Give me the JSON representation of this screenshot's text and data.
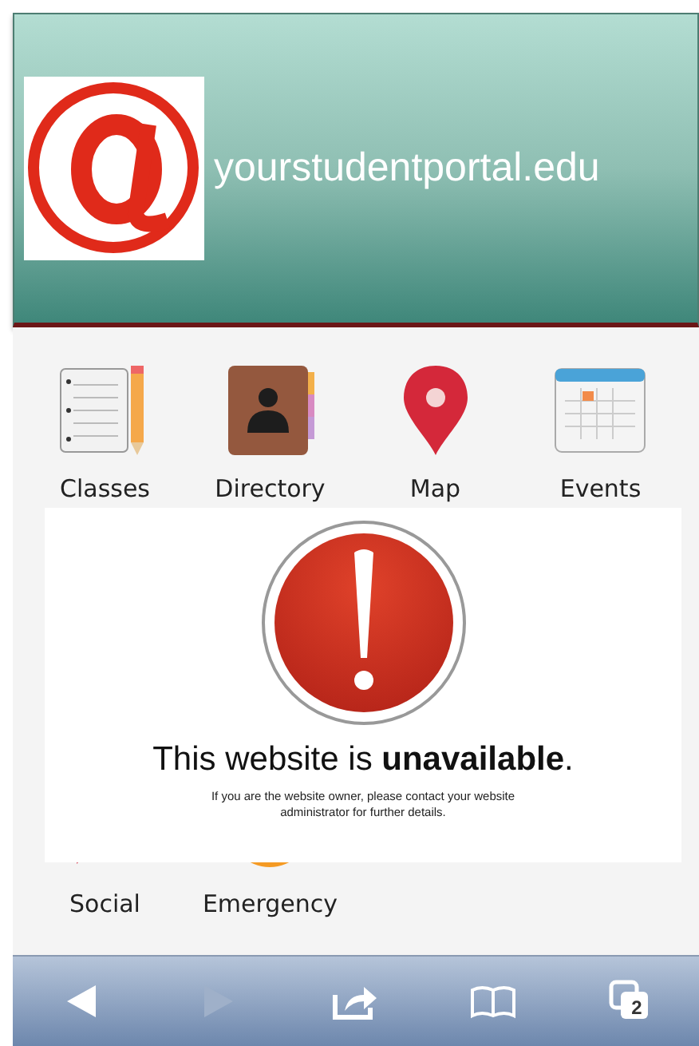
{
  "header": {
    "site_name": "yourstudentportal.edu"
  },
  "apps": [
    {
      "kind": "classes",
      "label": "Classes"
    },
    {
      "kind": "directory",
      "label": "Directory"
    },
    {
      "kind": "map",
      "label": "Map"
    },
    {
      "kind": "events",
      "label": "Events"
    },
    {
      "kind": "social",
      "label": "Social"
    },
    {
      "kind": "emergency",
      "label": "Emergency"
    }
  ],
  "alert": {
    "title": "This website is **unavailable**.",
    "message": "If you are the website owner, please contact your website administrator for further details."
  },
  "toolbar": {
    "back": {
      "disabled": false
    },
    "forward": {
      "disabled": true
    },
    "tabs_count": "2"
  }
}
